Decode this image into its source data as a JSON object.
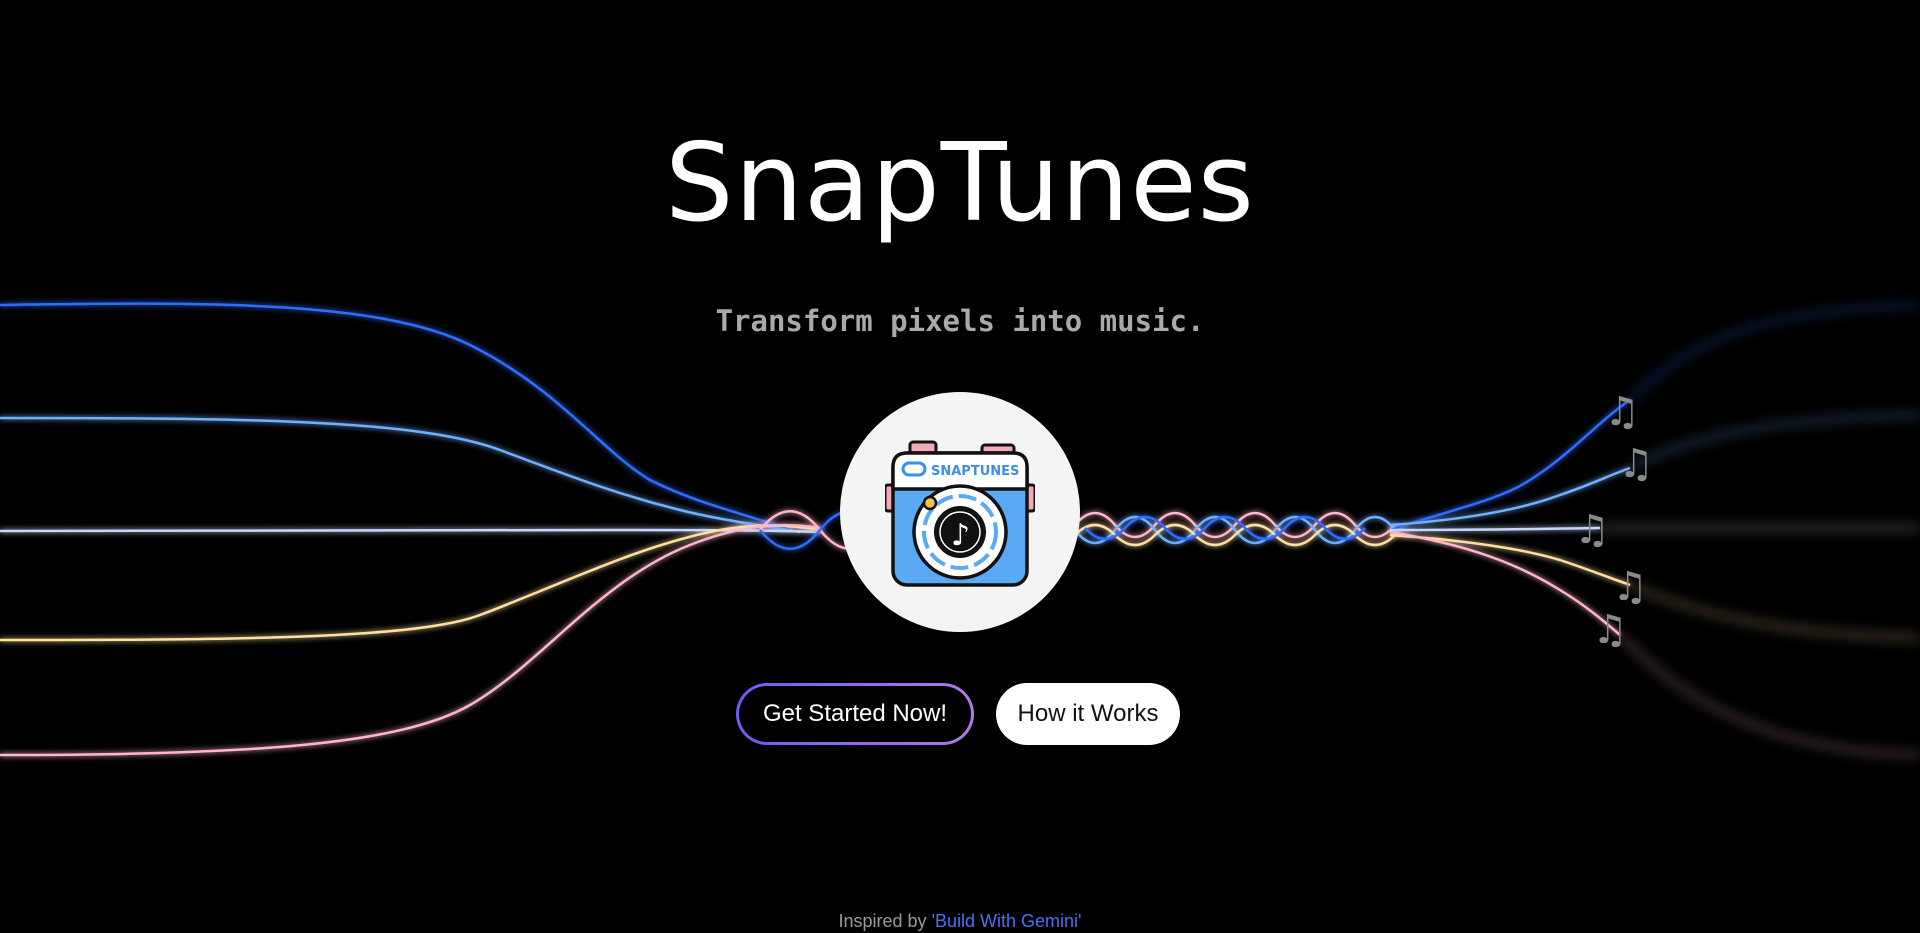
{
  "hero": {
    "title": "SnapTunes",
    "tagline": "Transform pixels into music."
  },
  "logo": {
    "label": "SNAPTUNES",
    "icon": "camera-music-note-icon"
  },
  "actions": {
    "primary_label": "Get Started Now!",
    "secondary_label": "How it Works"
  },
  "footer": {
    "prefix": "Inspired by ",
    "link_text": "'Build With Gemini'"
  },
  "decor": {
    "note_icon": "music-notes-icon",
    "note_glyph": "♫",
    "wave_colors": [
      "#2f6dff",
      "#6fb0ff",
      "#c7d7ff",
      "#ffe0a0",
      "#ffb6c8"
    ]
  }
}
